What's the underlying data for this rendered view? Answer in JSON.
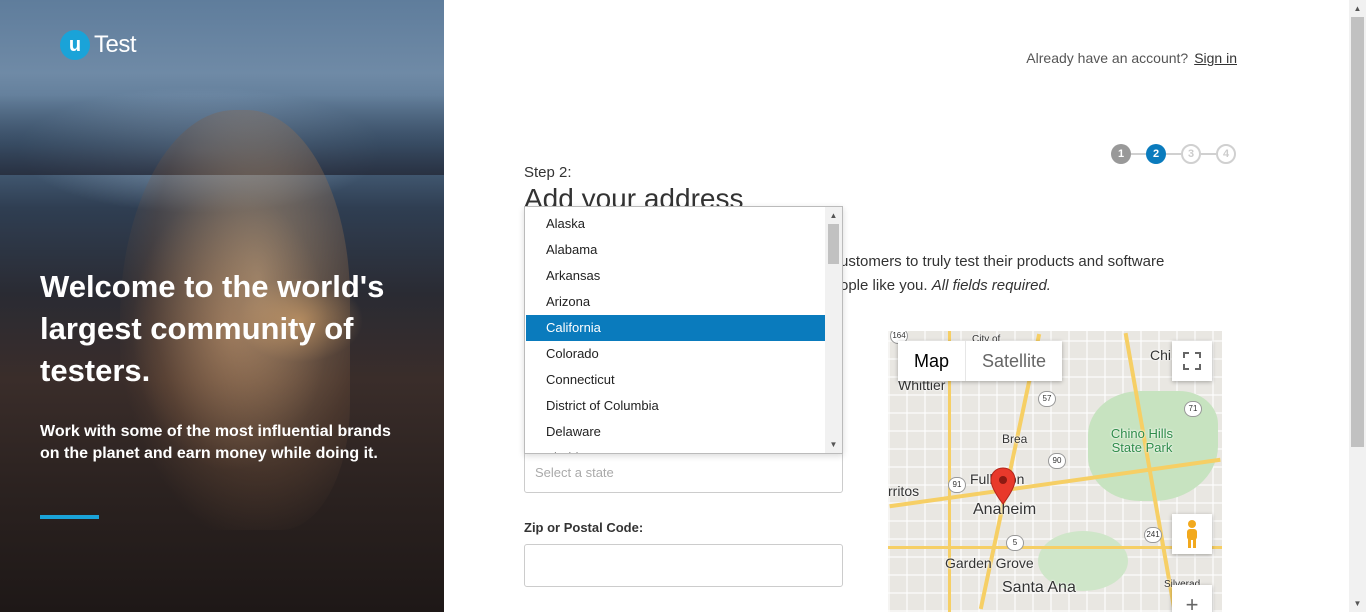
{
  "brand": {
    "logo_letter": "u",
    "logo_word": "Test"
  },
  "hero": {
    "title": "Welcome to the world's largest community of testers.",
    "subtitle": "Work with some of the most influential brands on the planet and earn money while doing it."
  },
  "signin": {
    "prompt": "Already have an account?",
    "link": "Sign in"
  },
  "steps": [
    "1",
    "2",
    "3",
    "4"
  ],
  "form": {
    "step_label": "Step 2:",
    "title": "Add your address",
    "intro_line1": "ustomers to truly test their products and software",
    "intro_line2_prefix": "ople like you.",
    "intro_line2_emph": "All fields required.",
    "state_placeholder": "Select a state",
    "zip_label": "Zip or Postal Code:",
    "zip_value": ""
  },
  "state_options": [
    "Alaska",
    "Alabama",
    "Arkansas",
    "Arizona",
    "California",
    "Colorado",
    "Connecticut",
    "District of Columbia",
    "Delaware",
    "Florida"
  ],
  "selected_state": "California",
  "map": {
    "type_map": "Map",
    "type_satellite": "Satellite",
    "places": {
      "whittier": "Whittier",
      "brea": "Brea",
      "chino_hills": "Chino Hills State Park",
      "chi": "Chi",
      "fullerton": "Fullerton",
      "anaheim": "Anaheim",
      "ritos": "rritos",
      "garden_grove": "Garden Grove",
      "santa_ana": "Santa Ana",
      "city_of": "City of",
      "silverado": "Silverad"
    },
    "shields": {
      "s164": "164",
      "s57": "57",
      "s90": "90",
      "s91": "91",
      "s5": "5",
      "s241": "241",
      "s71": "71"
    }
  }
}
